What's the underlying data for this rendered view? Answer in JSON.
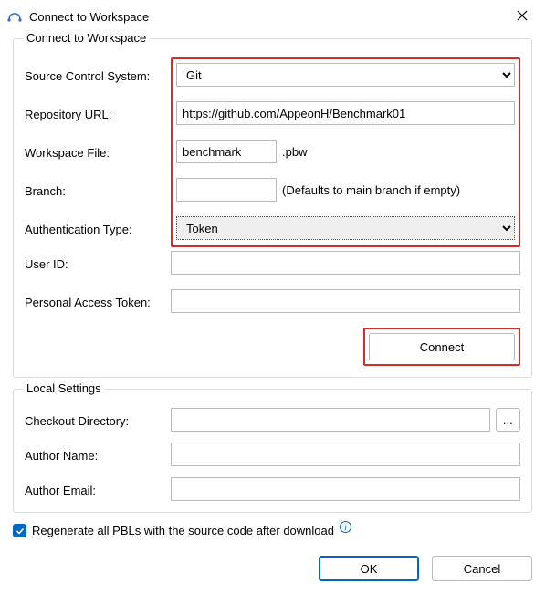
{
  "window": {
    "title": "Connect to Workspace"
  },
  "connect_group": {
    "legend": "Connect to Workspace",
    "source_control_label": "Source Control System:",
    "source_control_value": "Git",
    "repo_url_label": "Repository URL:",
    "repo_url_value": "https://github.com/AppeonH/Benchmark01",
    "workspace_file_label": "Workspace File:",
    "workspace_file_value": "benchmark",
    "workspace_file_suffix": ".pbw",
    "branch_label": "Branch:",
    "branch_value": "",
    "branch_hint": "(Defaults to main branch if empty)",
    "auth_type_label": "Authentication Type:",
    "auth_type_value": "Token",
    "user_id_label": "User ID:",
    "user_id_value": "",
    "pat_label": "Personal Access Token:",
    "pat_value": "",
    "connect_button": "Connect"
  },
  "local_group": {
    "legend": "Local Settings",
    "checkout_dir_label": "Checkout Directory:",
    "checkout_dir_value": "",
    "browse_label": "...",
    "author_name_label": "Author Name:",
    "author_name_value": "",
    "author_email_label": "Author Email:",
    "author_email_value": ""
  },
  "regenerate": {
    "checked": true,
    "label": "Regenerate all PBLs with the source code after download"
  },
  "buttons": {
    "ok": "OK",
    "cancel": "Cancel"
  }
}
